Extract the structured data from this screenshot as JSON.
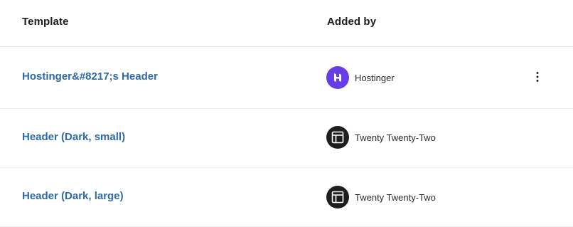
{
  "columns": {
    "template": "Template",
    "added_by": "Added by"
  },
  "rows": [
    {
      "title": "Hostinger&#8217;s Header",
      "author": "Hostinger",
      "avatar": "hostinger-logo-icon",
      "has_actions": true
    },
    {
      "title": "Header (Dark, small)",
      "author": "Twenty Twenty-Two",
      "avatar": "layout-icon",
      "has_actions": false
    },
    {
      "title": "Header (Dark, large)",
      "author": "Twenty Twenty-Two",
      "avatar": "layout-icon",
      "has_actions": false
    }
  ],
  "colors": {
    "link": "#2f6aa6",
    "hostinger_purple": "#673de6",
    "theme_avatar": "#1e1e1e"
  }
}
